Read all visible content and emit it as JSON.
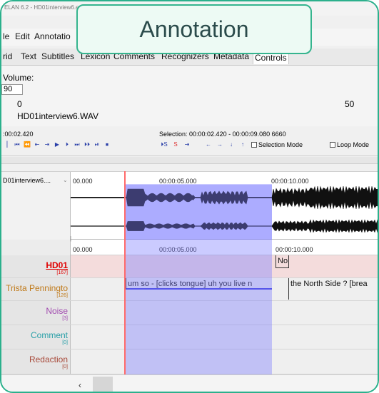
{
  "window": {
    "title": "ELAN 6.2 - HD01interview6.eaf"
  },
  "menu": [
    "le",
    "Edit",
    "Annotatio"
  ],
  "tabs": [
    "rid",
    "Text",
    "Subtitles",
    "Lexicon",
    "Comments",
    "Recognizers",
    "Metadata",
    "Controls"
  ],
  "controls": {
    "volume_label": "Volume:",
    "volume_value": "90",
    "slider_min": "0",
    "slider_max": "50",
    "media_file": "HD01interview6.WAV"
  },
  "player": {
    "current_time": ":00:02.420",
    "selection_text": "Selection: 00:00:02.420 - 00:00:09.080  6660",
    "buttons": [
      "⎮",
      "⏮",
      "⏪",
      "⇤",
      "⇥",
      "▶",
      "⏵",
      "⏭",
      "⏵⏵",
      "⏯",
      "⏹"
    ],
    "transport_buttons": [
      "⏵S",
      "S",
      "⇥"
    ],
    "nav_buttons": [
      "←",
      "→",
      "↓",
      "↑"
    ],
    "selection_mode": "Selection Mode",
    "loop_mode": "Loop Mode"
  },
  "waveform": {
    "track_name": "D01interview6....",
    "times": [
      "00.000",
      "00:00:05.000",
      "00:00:10.000"
    ]
  },
  "annotation_ruler": {
    "times": [
      "00.000",
      "00:00:05.000",
      "00:00:10.000"
    ]
  },
  "tiers": [
    {
      "name": "HD01",
      "count": "[167]",
      "color": "#e00000",
      "underline": true
    },
    {
      "name": "Trista Penningto",
      "count": "[126]",
      "color": "#c07a1a",
      "underline": false
    },
    {
      "name": "Noise",
      "count": "[3]",
      "color": "#a24cb0",
      "underline": false
    },
    {
      "name": "Comment",
      "count": "[0]",
      "color": "#2aa0a8",
      "underline": false
    },
    {
      "name": "Redaction",
      "count": "[0]",
      "color": "#a84a3a",
      "underline": false
    }
  ],
  "segments": {
    "hd01_short": "No",
    "trista_1": "um so - [clicks tongue] uh you live n",
    "trista_2": "the North Side ? [brea"
  },
  "badge": {
    "text": "Annotation"
  },
  "colors": {
    "accent": "#2bb08c",
    "selection": "#7e7eff",
    "cursor": "#ff6a6a",
    "waveform": "#111111"
  }
}
